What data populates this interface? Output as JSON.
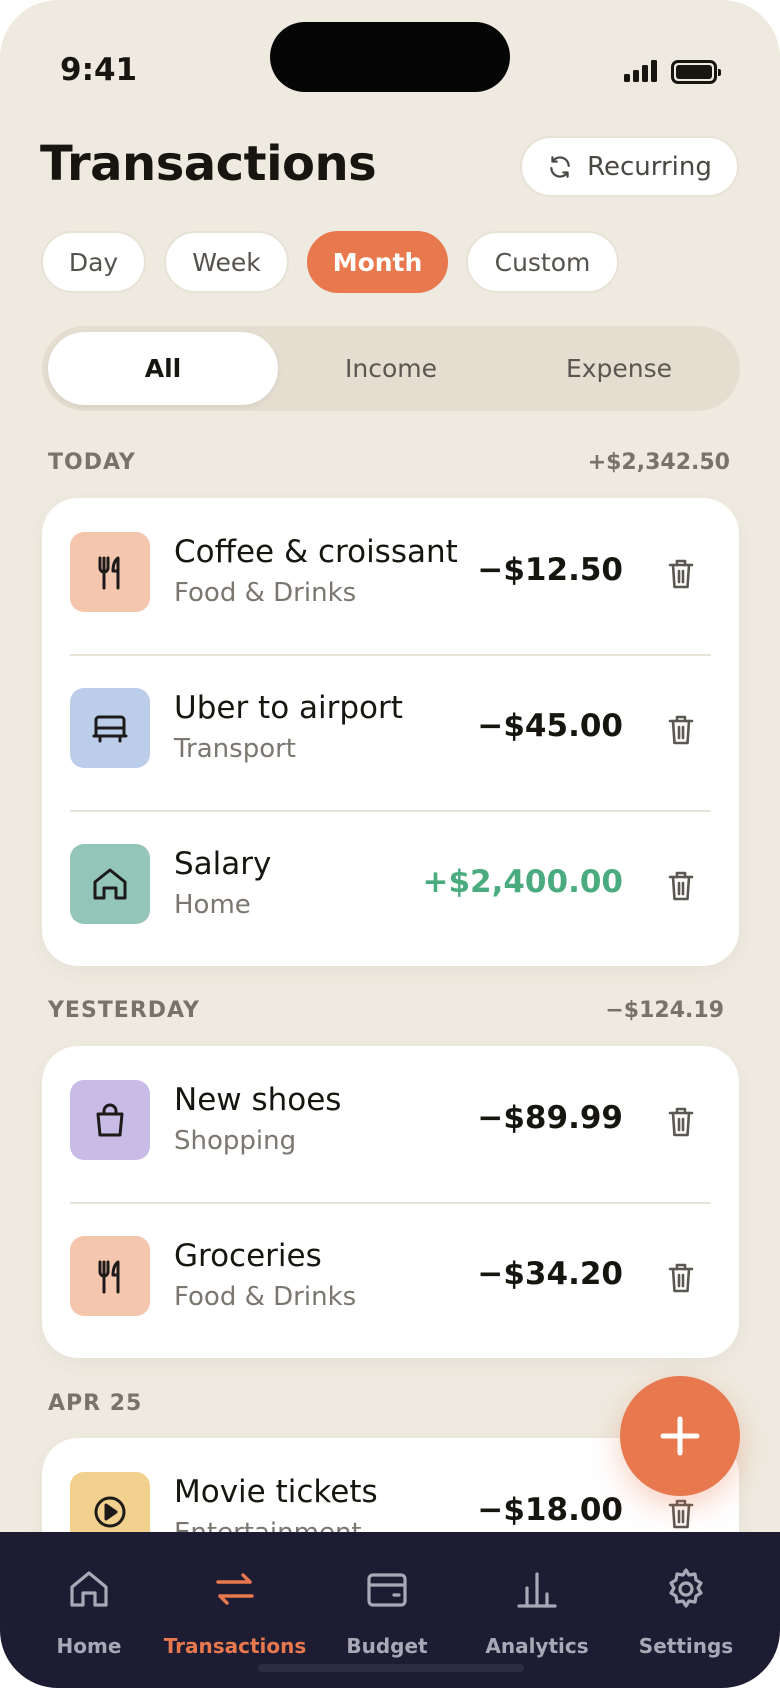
{
  "status_bar": {
    "time": "9:41"
  },
  "header": {
    "title": "Transactions",
    "recurring_label": "Recurring"
  },
  "period_chips": [
    {
      "label": "Day",
      "active": false
    },
    {
      "label": "Week",
      "active": false
    },
    {
      "label": "Month",
      "active": true
    },
    {
      "label": "Custom",
      "active": false
    }
  ],
  "type_filter": [
    {
      "label": "All",
      "active": true
    },
    {
      "label": "Income",
      "active": false
    },
    {
      "label": "Expense",
      "active": false
    }
  ],
  "sections": [
    {
      "label": "TODAY",
      "total": "+$2,342.50",
      "transactions": [
        {
          "title": "Coffee & croissant",
          "category": "Food & Drinks",
          "amount": "−$12.50",
          "type": "expense",
          "icon": "fork-knife-icon",
          "icon_bg": "#f4c6ad"
        },
        {
          "title": "Uber to airport",
          "category": "Transport",
          "amount": "−$45.00",
          "type": "expense",
          "icon": "car-icon",
          "icon_bg": "#bccde9"
        },
        {
          "title": "Salary",
          "category": "Home",
          "amount": "+$2,400.00",
          "type": "income",
          "icon": "home-icon",
          "icon_bg": "#93c5b9"
        }
      ]
    },
    {
      "label": "YESTERDAY",
      "total": "−$124.19",
      "transactions": [
        {
          "title": "New shoes",
          "category": "Shopping",
          "amount": "−$89.99",
          "type": "expense",
          "icon": "shopping-bag-icon",
          "icon_bg": "#c8bbe6"
        },
        {
          "title": "Groceries",
          "category": "Food & Drinks",
          "amount": "−$34.20",
          "type": "expense",
          "icon": "fork-knife-icon",
          "icon_bg": "#f4c6ad"
        }
      ]
    },
    {
      "label": "APR 25",
      "total": "",
      "transactions": [
        {
          "title": "Movie tickets",
          "category": "Entertainment",
          "amount": "−$18.00",
          "type": "expense",
          "icon": "play-icon",
          "icon_bg": "#f2d08e"
        }
      ]
    }
  ],
  "tabbar": [
    {
      "label": "Home",
      "icon": "home-icon",
      "active": false
    },
    {
      "label": "Transactions",
      "icon": "transfer-arrows-icon",
      "active": true
    },
    {
      "label": "Budget",
      "icon": "wallet-icon",
      "active": false
    },
    {
      "label": "Analytics",
      "icon": "bar-chart-icon",
      "active": false
    },
    {
      "label": "Settings",
      "icon": "gear-icon",
      "active": false
    }
  ],
  "colors": {
    "accent": "#e8784d",
    "income": "#4aac7e",
    "background": "#eeeae0",
    "tabbar": "#1d1c32"
  },
  "fab": {
    "icon": "plus-icon"
  }
}
